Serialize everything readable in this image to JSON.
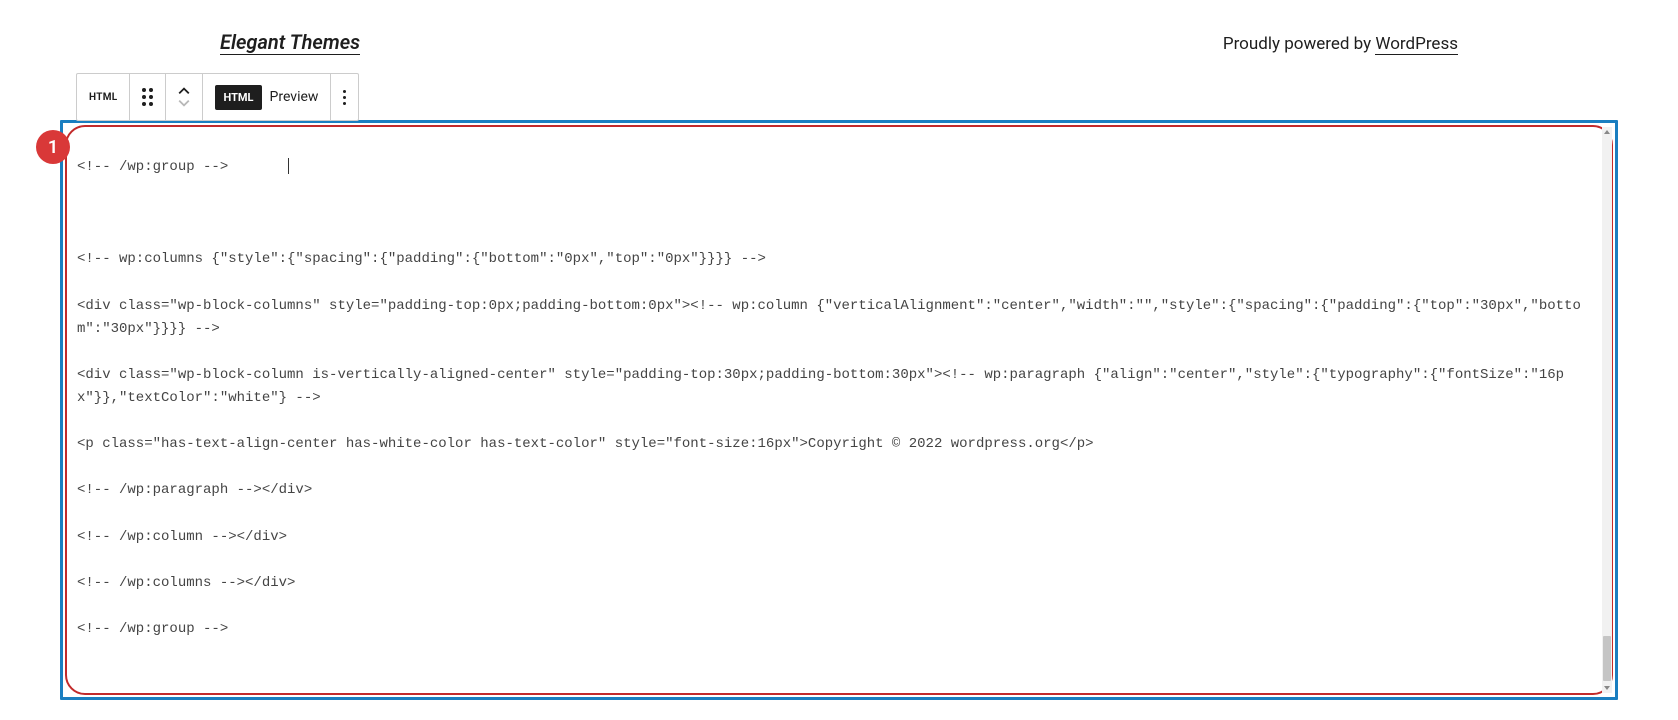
{
  "header": {
    "left_link": "Elegant Themes",
    "powered_prefix": "Proudly powered by ",
    "powered_link": "WordPress"
  },
  "toolbar": {
    "block_type": "HTML",
    "html_tab": "HTML",
    "preview_tab": "Preview"
  },
  "marker": {
    "label": "1"
  },
  "code": {
    "line1": "<!-- /wp:group -->",
    "line2": "<!-- wp:columns {\"style\":{\"spacing\":{\"padding\":{\"bottom\":\"0px\",\"top\":\"0px\"}}}} -->",
    "line3": "<div class=\"wp-block-columns\" style=\"padding-top:0px;padding-bottom:0px\"><!-- wp:column {\"verticalAlignment\":\"center\",\"width\":\"\",\"style\":{\"spacing\":{\"padding\":{\"top\":\"30px\",\"bottom\":\"30px\"}}}} -->",
    "line4": "<div class=\"wp-block-column is-vertically-aligned-center\" style=\"padding-top:30px;padding-bottom:30px\"><!-- wp:paragraph {\"align\":\"center\",\"style\":{\"typography\":{\"fontSize\":\"16px\"}},\"textColor\":\"white\"} -->",
    "line5": "<p class=\"has-text-align-center has-white-color has-text-color\" style=\"font-size:16px\">Copyright © 2022 wordpress.org</p>",
    "line6": "<!-- /wp:paragraph --></div>",
    "line7": "<!-- /wp:column --></div>",
    "line8": "<!-- /wp:columns --></div>",
    "line9": "<!-- /wp:group -->"
  }
}
